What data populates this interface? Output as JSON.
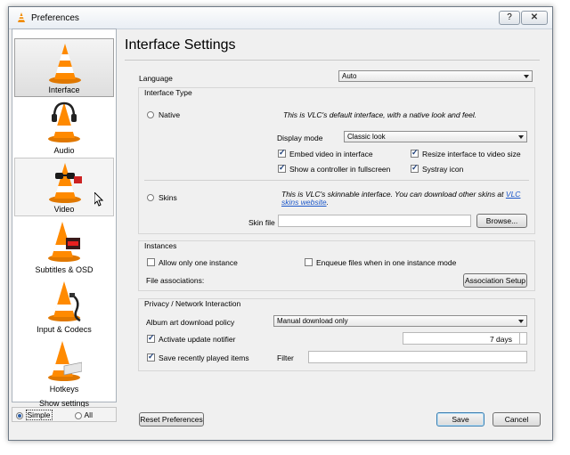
{
  "window": {
    "title": "Preferences",
    "help_label": "?",
    "close_label": "✕"
  },
  "sidebar": {
    "items": [
      {
        "label": "Interface",
        "icon": "vlc-cone-icon"
      },
      {
        "label": "Audio",
        "icon": "vlc-cone-headphones-icon"
      },
      {
        "label": "Video",
        "icon": "vlc-cone-glasses-icon"
      },
      {
        "label": "Subtitles & OSD",
        "icon": "vlc-cone-display-icon"
      },
      {
        "label": "Input & Codecs",
        "icon": "vlc-cone-cable-icon"
      },
      {
        "label": "Hotkeys",
        "icon": "vlc-cone-keyboard-icon"
      }
    ],
    "show_settings": {
      "title": "Show settings",
      "simple": "Simple",
      "all": "All"
    }
  },
  "main": {
    "heading": "Interface Settings",
    "language_label": "Language",
    "language_value": "Auto",
    "interface_type": {
      "title": "Interface Type",
      "native_label": "Native",
      "native_desc": "This is VLC's default interface, with a native look and feel.",
      "display_mode_label": "Display mode",
      "display_mode_value": "Classic look",
      "embed_video": "Embed video in interface",
      "resize_interface": "Resize interface to video size",
      "show_controller": "Show a controller in fullscreen",
      "systray": "Systray icon",
      "skins_label": "Skins",
      "skins_desc": "This is VLC's skinnable interface. You can download other skins at",
      "skins_link1": "VLC",
      "skins_link2": "skins website",
      "skins_link_end": ".",
      "skin_file_label": "Skin file",
      "browse_label": "Browse..."
    },
    "instances": {
      "title": "Instances",
      "allow_one": "Allow only one instance",
      "enqueue": "Enqueue files when in one instance mode",
      "file_assoc_label": "File associations:",
      "assoc_button": "Association Setup"
    },
    "privacy": {
      "title": "Privacy / Network Interaction",
      "album_art_label": "Album art download policy",
      "album_art_value": "Manual download only",
      "update_notifier": "Activate update notifier",
      "update_days": "7 days",
      "save_recent": "Save recently played items",
      "filter_label": "Filter"
    }
  },
  "footer": {
    "reset": "Reset Preferences",
    "save": "Save",
    "cancel": "Cancel"
  }
}
